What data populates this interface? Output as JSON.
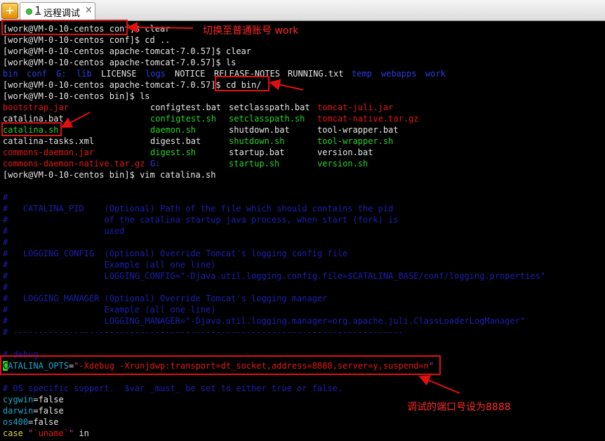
{
  "tab": {
    "new_icon": "+",
    "number": "1",
    "title": "远程调试",
    "close": "×"
  },
  "terminal": {
    "l0a": "[work@VM-0-10-centos conf]$ ",
    "l0b": "clear",
    "l1": "[work@VM-0-10-centos conf]$ cd ..",
    "l2": "[work@VM-0-10-centos apache-tomcat-7.0.57]$ clear",
    "l3": "[work@VM-0-10-centos apache-tomcat-7.0.57]$ ls",
    "ls1": {
      "bin": "bin",
      "conf": "conf",
      "G": "G:",
      "lib": "lib",
      "license": "LICENSE",
      "logs": "logs",
      "notice": "NOTICE",
      "release": "RELEASE-NOTES",
      "running": "RUNNING.txt",
      "temp": "temp",
      "webapps": "webapps",
      "work": "work"
    },
    "l5a": "[work@VM-0-10-centos apache-tomcat-7.0.57]$ ",
    "l5b": "cd bin/",
    "l6": "[work@VM-0-10-centos bin]$ ls",
    "files": {
      "r1": [
        "bootstrap.jar",
        "configtest.bat",
        "setclasspath.bat",
        "tomcat-juli.jar"
      ],
      "r2": [
        "catalina.bat",
        "configtest.sh",
        "setclasspath.sh",
        "tomcat-native.tar.gz"
      ],
      "r3": [
        "catalina.sh",
        "daemon.sh",
        "shutdown.bat",
        "tool-wrapper.bat"
      ],
      "r4": [
        "catalina-tasks.xml",
        "digest.bat",
        "shutdown.sh",
        "tool-wrapper.sh"
      ],
      "r5": [
        "commons-daemon.jar",
        "digest.sh",
        "startup.bat",
        "version.bat"
      ],
      "r6": [
        "commons-daemon-native.tar.gz",
        "G:",
        "startup.sh",
        "version.sh"
      ]
    },
    "l13": "[work@VM-0-10-centos bin]$ vim catalina.sh",
    "vim": {
      "c0": "#",
      "c1": "#   CATALINA_PID    (Optional) Path of the file which should contains the pid",
      "c2": "#                   of the catalina startup java process, when start (fork) is",
      "c3": "#                   used",
      "c4": "#",
      "c5": "#   LOGGING_CONFIG  (Optional) Override Tomcat's logging config file",
      "c6": "#                   Example (all one line)",
      "c7": "#                   LOGGING_CONFIG=\"-Djava.util.logging.config.file=$CATALINA_BASE/conf/logging.properties\"",
      "c8": "#",
      "c9": "#   LOGGING_MANAGER (Optional) Override Tomcat's logging manager",
      "c10": "#                   Example (all one line)",
      "c11": "#                   LOGGING_MANAGER=\"-Djava.util.logging.manager=org.apache.juli.ClassLoaderLogManager\"",
      "c12": "# -----------------------------------------------------------------------------",
      "c13": "# debug",
      "opts": {
        "cursor": "C",
        "var": "ATALINA_OPTS",
        "eq": "=",
        "q1": "\"",
        "value": "-Xdebug -Xrunjdwp:transport=dt_socket,address=8888,server=y,suspend=n",
        "q2": "\""
      },
      "c15": "# OS specific support.  $var _must_ be set to either true or false.",
      "cyg": {
        "k": "cygwin",
        "v": "=false"
      },
      "dar": {
        "k": "darwin",
        "v": "=false"
      },
      "os4": {
        "k": "os400",
        "v": "=false"
      },
      "case": {
        "k": "case",
        "q1": " \"",
        "bt": "`uname`",
        "q2": "\"",
        "in": " in"
      }
    }
  },
  "annotations": {
    "a1": "切换至普通账号 work",
    "a2": "调试的端口号设为8888"
  },
  "colors": {
    "annotation": "#ff2a2a",
    "terminal_bg": "#000000",
    "dir": "#2f3be0",
    "archive": "#e01818",
    "exec": "#28d228",
    "comment": "#1d1db0"
  }
}
